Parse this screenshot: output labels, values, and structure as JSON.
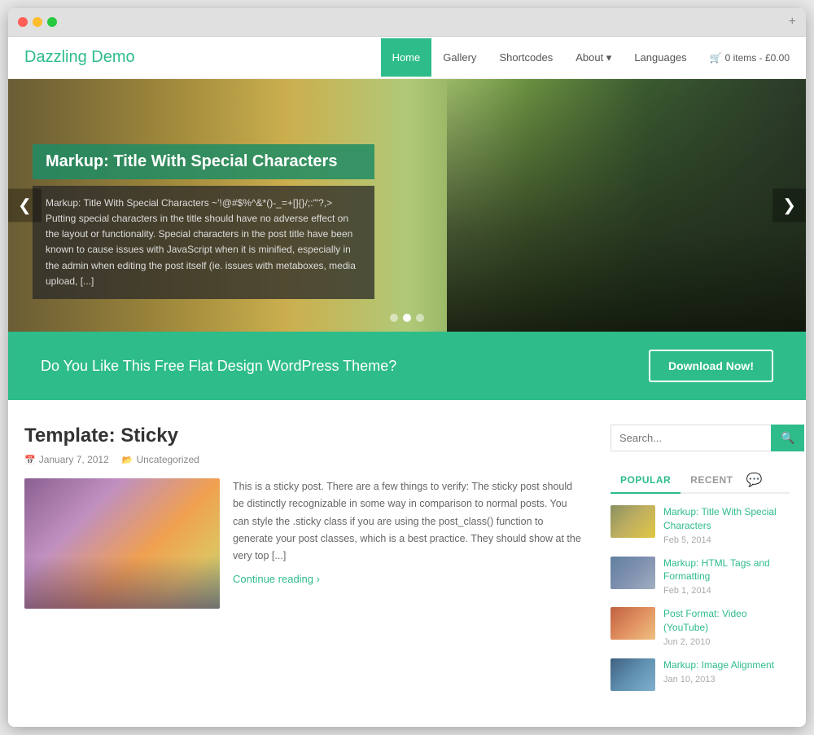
{
  "browser": {
    "dots": [
      "red",
      "yellow",
      "green"
    ],
    "plus": "+"
  },
  "header": {
    "logo": "Dazzling Demo",
    "nav": [
      {
        "label": "Home",
        "active": true,
        "dropdown": false
      },
      {
        "label": "Gallery",
        "active": false,
        "dropdown": false
      },
      {
        "label": "Shortcodes",
        "active": false,
        "dropdown": false
      },
      {
        "label": "About",
        "active": false,
        "dropdown": true
      },
      {
        "label": "Languages",
        "active": false,
        "dropdown": false
      }
    ],
    "cart": "0 items - £0.00"
  },
  "hero": {
    "title": "Markup: Title With Special Characters",
    "text": "Markup: Title With Special Characters ~'!@#$%^&*()-_=+[]{}/;:'\"?,> Putting special characters in the title should have no adverse effect on the layout or functionality. Special characters in the post title have been known to cause issues with JavaScript when it is minified, especially in the admin when editing the post itself (ie. issues with metaboxes, media upload, [...]",
    "arrow_left": "❮",
    "arrow_right": "❯",
    "dots": [
      {
        "active": false
      },
      {
        "active": true
      },
      {
        "active": false
      }
    ]
  },
  "cta": {
    "text": "Do You Like This Free Flat Design WordPress Theme?",
    "button_label": "Download Now!"
  },
  "post": {
    "title": "Template: Sticky",
    "date": "January 7, 2012",
    "category": "Uncategorized",
    "excerpt": "This is a sticky post. There are a few things to verify: The sticky post should be distinctly recognizable in some way in comparison to normal posts. You can style the .sticky class if you are using the post_class() function to generate your post classes, which is a best practice. They should show at the very top [...]",
    "continue": "Continue reading"
  },
  "sidebar": {
    "search_placeholder": "Search...",
    "tabs": [
      {
        "label": "POPULAR",
        "active": true
      },
      {
        "label": "RECENT",
        "active": false
      }
    ],
    "tab_icon": "💬",
    "posts": [
      {
        "title": "Markup: Title With Special Characters",
        "date": "Feb 5, 2014",
        "thumb_class": "thumb-1"
      },
      {
        "title": "Markup: HTML Tags and Formatting",
        "date": "Feb 1, 2014",
        "thumb_class": "thumb-2"
      },
      {
        "title": "Post Format: Video (YouTube)",
        "date": "Jun 2, 2010",
        "thumb_class": "thumb-3"
      },
      {
        "title": "Markup: Image Alignment",
        "date": "Jan 10, 2013",
        "thumb_class": "thumb-4"
      }
    ]
  },
  "colors": {
    "green": "#2ebc8a"
  }
}
